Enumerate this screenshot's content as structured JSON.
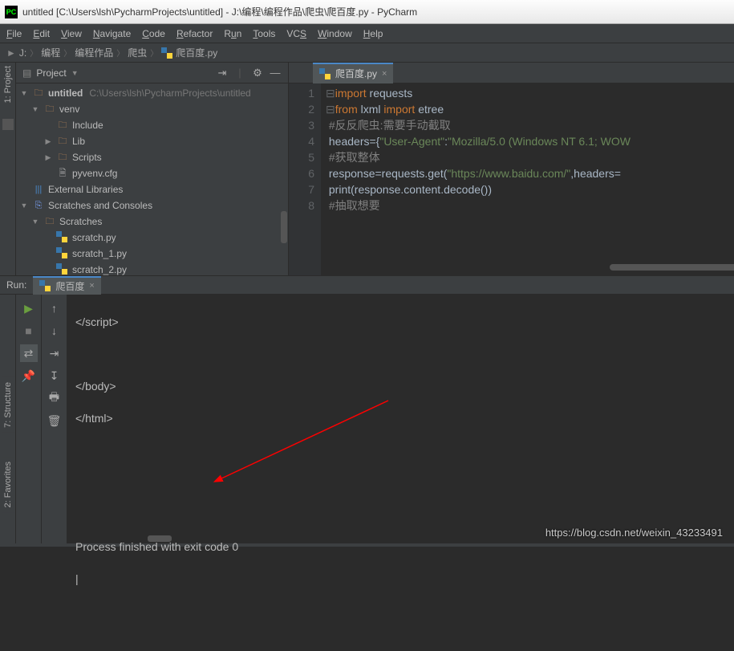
{
  "title": "untitled [C:\\Users\\lsh\\PycharmProjects\\untitled] - J:\\编程\\编程作品\\爬虫\\爬百度.py - PyCharm",
  "menu": [
    "File",
    "Edit",
    "View",
    "Navigate",
    "Code",
    "Refactor",
    "Run",
    "Tools",
    "VCS",
    "Window",
    "Help"
  ],
  "breadcrumbs": [
    "J:",
    "编程",
    "编程作品",
    "爬虫",
    "爬百度.py"
  ],
  "project_header": "Project",
  "left_tool_label": "1: Project",
  "structure_label": "7: Structure",
  "favorites_label": "2: Favorites",
  "tree": {
    "root": {
      "label": "untitled",
      "hint": "C:\\Users\\lsh\\PycharmProjects\\untitled"
    },
    "venv": "venv",
    "include": "Include",
    "lib": "Lib",
    "scripts": "Scripts",
    "pyvenv": "pyvenv.cfg",
    "external": "External Libraries",
    "scratches_consoles": "Scratches and Consoles",
    "scratches": "Scratches",
    "scratch_py": "scratch.py",
    "scratch_1": "scratch_1.py",
    "scratch_2": "scratch_2.py"
  },
  "editor_tab": "爬百度.py",
  "code_lines": [
    "1",
    "2",
    "3",
    "4",
    "5",
    "6",
    "7",
    "8"
  ],
  "code": {
    "l1a": "import",
    "l1b": " requests",
    "l2a": "from",
    "l2b": " lxml ",
    "l2c": "import",
    "l2d": " etree",
    "l3": "#反反爬虫:需要手动截取",
    "l4a": "headers={",
    "l4b": "\"User-Agent\"",
    "l4c": ":",
    "l4d": "\"Mozilla/5.0 (Windows NT 6.1; WOW",
    "l5": "#获取整体",
    "l6a": "response=requests.get(",
    "l6b": "\"https://www.baidu.com/\"",
    "l6c": ",headers=",
    "l7": "print(response.content.decode())",
    "l8": "#抽取想要"
  },
  "run_label": "Run:",
  "run_tab": "爬百度",
  "console_lines": {
    "l1": "</script>",
    "blank1": "",
    "blank2": "",
    "l2": "</body>",
    "l3": "</html>",
    "blank3": "",
    "blank4": "",
    "blank5": "",
    "blank6": "",
    "blank7": "",
    "blank8": "",
    "exit": "Process finished with exit code 0",
    "cursor": "|"
  },
  "watermark": "https://blog.csdn.net/weixin_43233491"
}
